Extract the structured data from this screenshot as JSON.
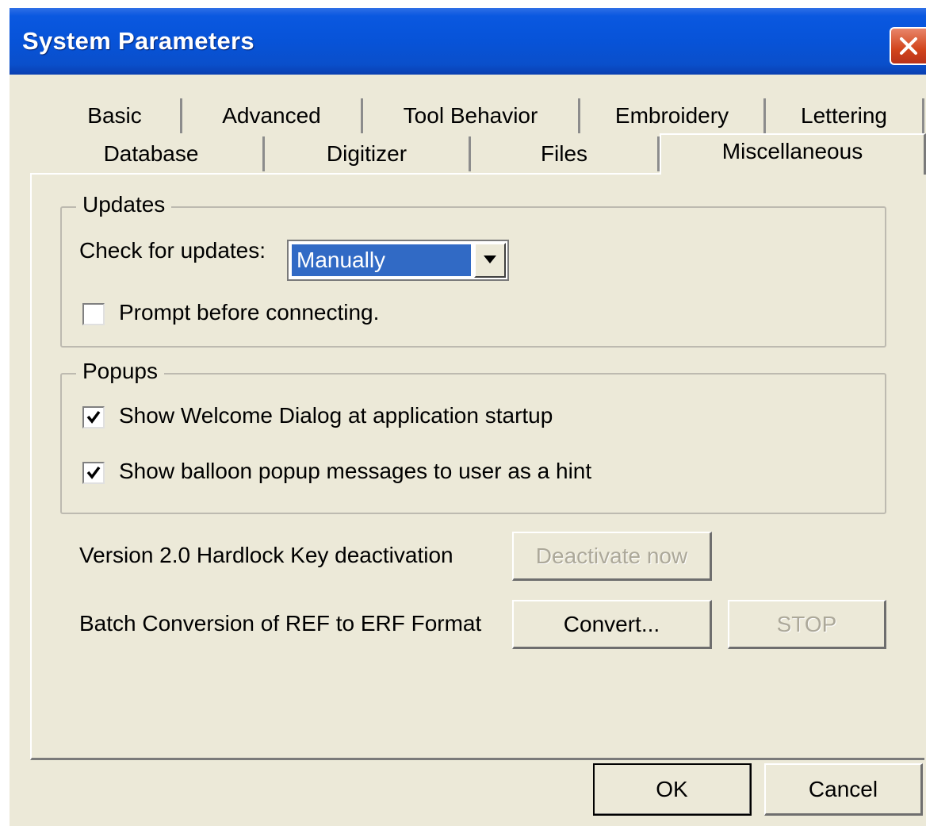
{
  "window": {
    "title": "System Parameters"
  },
  "tabs": {
    "row1": [
      "Basic",
      "Advanced",
      "Tool Behavior",
      "Embroidery",
      "Lettering"
    ],
    "row2": [
      "Database",
      "Digitizer",
      "Files",
      "Miscellaneous"
    ],
    "active": "Miscellaneous"
  },
  "updates": {
    "legend": "Updates",
    "check_label": "Check for updates:",
    "check_value": "Manually",
    "prompt_label": "Prompt before connecting.",
    "prompt_checked": false
  },
  "popups": {
    "legend": "Popups",
    "welcome_label": "Show Welcome Dialog at application startup",
    "welcome_checked": true,
    "balloon_label": "Show balloon popup messages to user as a hint",
    "balloon_checked": true
  },
  "hardlock": {
    "label": "Version 2.0 Hardlock Key deactivation",
    "button": "Deactivate now",
    "button_enabled": false
  },
  "batch": {
    "label": "Batch Conversion of REF to ERF Format",
    "convert_button": "Convert...",
    "stop_button": "STOP",
    "stop_enabled": false
  },
  "footer": {
    "ok": "OK",
    "cancel": "Cancel"
  },
  "icons": [
    "close-icon",
    "dropdown-arrow-icon",
    "checkmark-icon"
  ],
  "colors": {
    "titlebar": "#0753d8",
    "dialog": "#ece9d8",
    "selection": "#316ac5",
    "close": "#d2451c"
  }
}
